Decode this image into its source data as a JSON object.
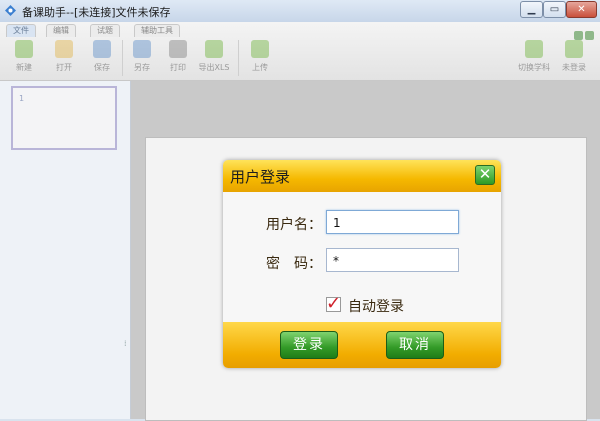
{
  "window": {
    "title": "备课助手--[未连接]文件未保存",
    "min_label": "▁",
    "max_label": "▭",
    "close_label": "✕"
  },
  "ribbon": {
    "tabs": [
      "文件",
      "编辑",
      "试题",
      "辅助工具"
    ],
    "tools": [
      {
        "label": "新建",
        "icon": "new-file-icon",
        "color": "#6fb33b"
      },
      {
        "label": "打开",
        "icon": "open-folder-icon",
        "color": "#e0b44a"
      },
      {
        "label": "保存",
        "icon": "save-icon",
        "color": "#5d8fc7"
      },
      {
        "label": "另存",
        "icon": "save-as-icon",
        "color": "#5d8fc7"
      },
      {
        "label": "打印",
        "icon": "print-icon",
        "color": "#808080"
      },
      {
        "label": "导出XLS",
        "icon": "export-icon",
        "color": "#6fb33b"
      },
      {
        "label": "上传",
        "icon": "upload-icon",
        "color": "#6fb33b"
      }
    ],
    "right_tools": [
      {
        "label": "切换学科",
        "icon": "switch-subject-icon",
        "color": "#6fb33b"
      },
      {
        "label": "未登录",
        "icon": "user-icon",
        "color": "#6fb33b"
      }
    ]
  },
  "slides": {
    "thumb_number": "1"
  },
  "login": {
    "title": "用户登录",
    "close_label": "✕",
    "username_label": "用户名：",
    "username_value": "1",
    "password_label": "密　码：",
    "password_value": "*",
    "auto_login_label": "自动登录",
    "auto_login_checked": true,
    "login_button": "登录",
    "cancel_button": "取消"
  }
}
